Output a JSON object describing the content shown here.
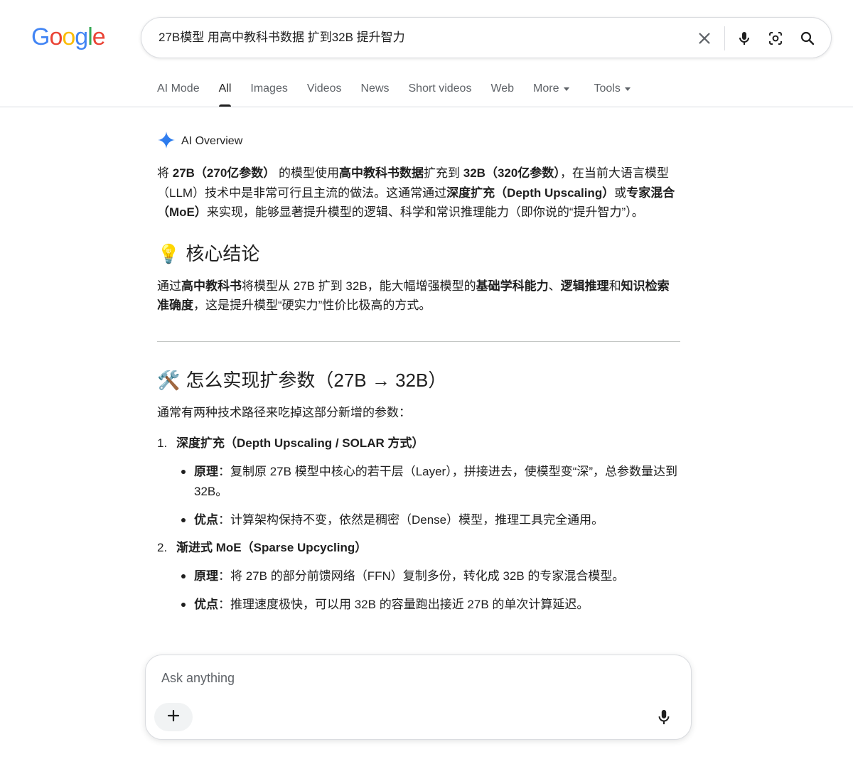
{
  "logo": {
    "letters": [
      "G",
      "o",
      "o",
      "g",
      "l",
      "e"
    ],
    "colors": [
      "#4285F4",
      "#EA4335",
      "#FBBC05",
      "#4285F4",
      "#34A853",
      "#EA4335"
    ]
  },
  "search": {
    "query": "27B模型 用高中教科书数据 扩到32B 提升智力",
    "icons": [
      "close-icon",
      "mic-icon",
      "lens-icon",
      "search-icon"
    ]
  },
  "tabs": [
    {
      "label": "AI Mode"
    },
    {
      "label": "All"
    },
    {
      "label": "Images"
    },
    {
      "label": "Videos"
    },
    {
      "label": "News"
    },
    {
      "label": "Short videos"
    },
    {
      "label": "Web"
    },
    {
      "label": "More"
    },
    {
      "label": "Tools"
    }
  ],
  "active_tab": "All",
  "overview": {
    "label": "AI Overview",
    "intro": [
      {
        "t": "将 ",
        "b": false
      },
      {
        "t": "27B（270亿参数）",
        "b": true
      },
      {
        "t": " 的模型使用",
        "b": false
      },
      {
        "t": "高中教科书数据",
        "b": true
      },
      {
        "t": "扩充到 ",
        "b": false
      },
      {
        "t": "32B（320亿参数）",
        "b": true
      },
      {
        "t": "，在当前大语言模型（LLM）技术中是非常可行且主流的做法。这通常通过",
        "b": false
      },
      {
        "t": "深度扩充（Depth Upscaling）",
        "b": true
      },
      {
        "t": "或",
        "b": false
      },
      {
        "t": "专家混合（MoE）",
        "b": true
      },
      {
        "t": "来实现，能够显著提升模型的逻辑、科学和常识推理能力（即你说的“提升智力”）。",
        "b": false
      }
    ],
    "section1": {
      "emoji": "💡",
      "title": "核心结论",
      "text": [
        {
          "t": "通过",
          "b": false
        },
        {
          "t": "高中教科书",
          "b": true
        },
        {
          "t": "将模型从 27B 扩到 32B，能大幅增强模型的",
          "b": false
        },
        {
          "t": "基础学科能力",
          "b": true
        },
        {
          "t": "、",
          "b": false
        },
        {
          "t": "逻辑推理",
          "b": true
        },
        {
          "t": "和",
          "b": false
        },
        {
          "t": "知识检索准确度",
          "b": true
        },
        {
          "t": "，这是提升模型“硬实力”性价比极高的方式。",
          "b": false
        }
      ]
    },
    "section2": {
      "emoji": "🛠️",
      "title": "怎么实现扩参数（27B → 32B）",
      "text": "通常有两种技术路径来吃掉这部分新增的参数：",
      "steps": [
        {
          "num": "1.",
          "label": "深度扩充（Depth Upscaling / SOLAR 方式）",
          "bullets": [
            {
              "key": "原理",
              "text": "：复制原 27B 模型中核心的若干层（Layer），拼接进去，使模型变“深”，总参数量达到 32B。"
            },
            {
              "key": "优点",
              "text": "：计算架构保持不变，依然是稠密（Dense）模型，推理工具完全通用。"
            }
          ]
        },
        {
          "num": "2.",
          "label": "渐进式 MoE（Sparse Upcycling）",
          "bullets": [
            {
              "key": "原理",
              "text": "：将 27B 的部分前馈网络（FFN）复制多份，转化成 32B 的专家混合模型。"
            },
            {
              "key": "优点",
              "text": "：推理速度极快，可以用 32B 的容量跑出接近 27B 的单次计算延迟。"
            }
          ]
        }
      ]
    }
  },
  "ask": {
    "placeholder": "Ask anything"
  }
}
